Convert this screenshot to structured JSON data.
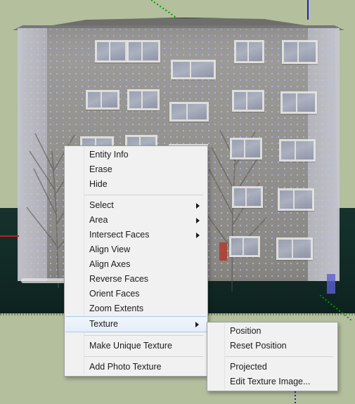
{
  "scene": {
    "description": "SketchUp 3D viewport showing a photo-textured apartment building box with selection dot pattern",
    "background_color": "#b4bf9e",
    "ground_color": "#132d28",
    "roof_color": "#6e6e6b",
    "axes": [
      {
        "name": "blue-axis",
        "color": "#2020c8"
      },
      {
        "name": "green-axis",
        "color": "#00a000"
      },
      {
        "name": "red-axis",
        "color": "#c02020"
      }
    ]
  },
  "context_menu": {
    "name": "face-context-menu",
    "background_color": "#f1f1f1",
    "border_color": "#a0a0a0",
    "highlight_color": "#e3edf9",
    "highlight_border_color": "#a8cbea",
    "items": [
      {
        "label": "Entity Info",
        "submenu": false,
        "separator_after": false
      },
      {
        "label": "Erase",
        "submenu": false,
        "separator_after": false
      },
      {
        "label": "Hide",
        "submenu": false,
        "separator_after": true
      },
      {
        "label": "Select",
        "submenu": true,
        "separator_after": false
      },
      {
        "label": "Area",
        "submenu": true,
        "separator_after": false
      },
      {
        "label": "Intersect Faces",
        "submenu": true,
        "separator_after": false
      },
      {
        "label": "Align View",
        "submenu": false,
        "separator_after": false
      },
      {
        "label": "Align Axes",
        "submenu": false,
        "separator_after": false
      },
      {
        "label": "Reverse Faces",
        "submenu": false,
        "separator_after": false
      },
      {
        "label": "Orient Faces",
        "submenu": false,
        "separator_after": false
      },
      {
        "label": "Zoom Extents",
        "submenu": false,
        "separator_after": false
      },
      {
        "label": "Texture",
        "submenu": true,
        "separator_after": true,
        "selected": true
      },
      {
        "label": "Make Unique Texture",
        "submenu": false,
        "separator_after": true
      },
      {
        "label": "Add Photo Texture",
        "submenu": false,
        "separator_after": false
      }
    ]
  },
  "texture_submenu": {
    "name": "texture-submenu",
    "items": [
      {
        "label": "Position",
        "separator_after": false
      },
      {
        "label": "Reset Position",
        "separator_after": true
      },
      {
        "label": "Projected",
        "separator_after": false
      },
      {
        "label": "Edit Texture Image...",
        "separator_after": false
      }
    ]
  }
}
